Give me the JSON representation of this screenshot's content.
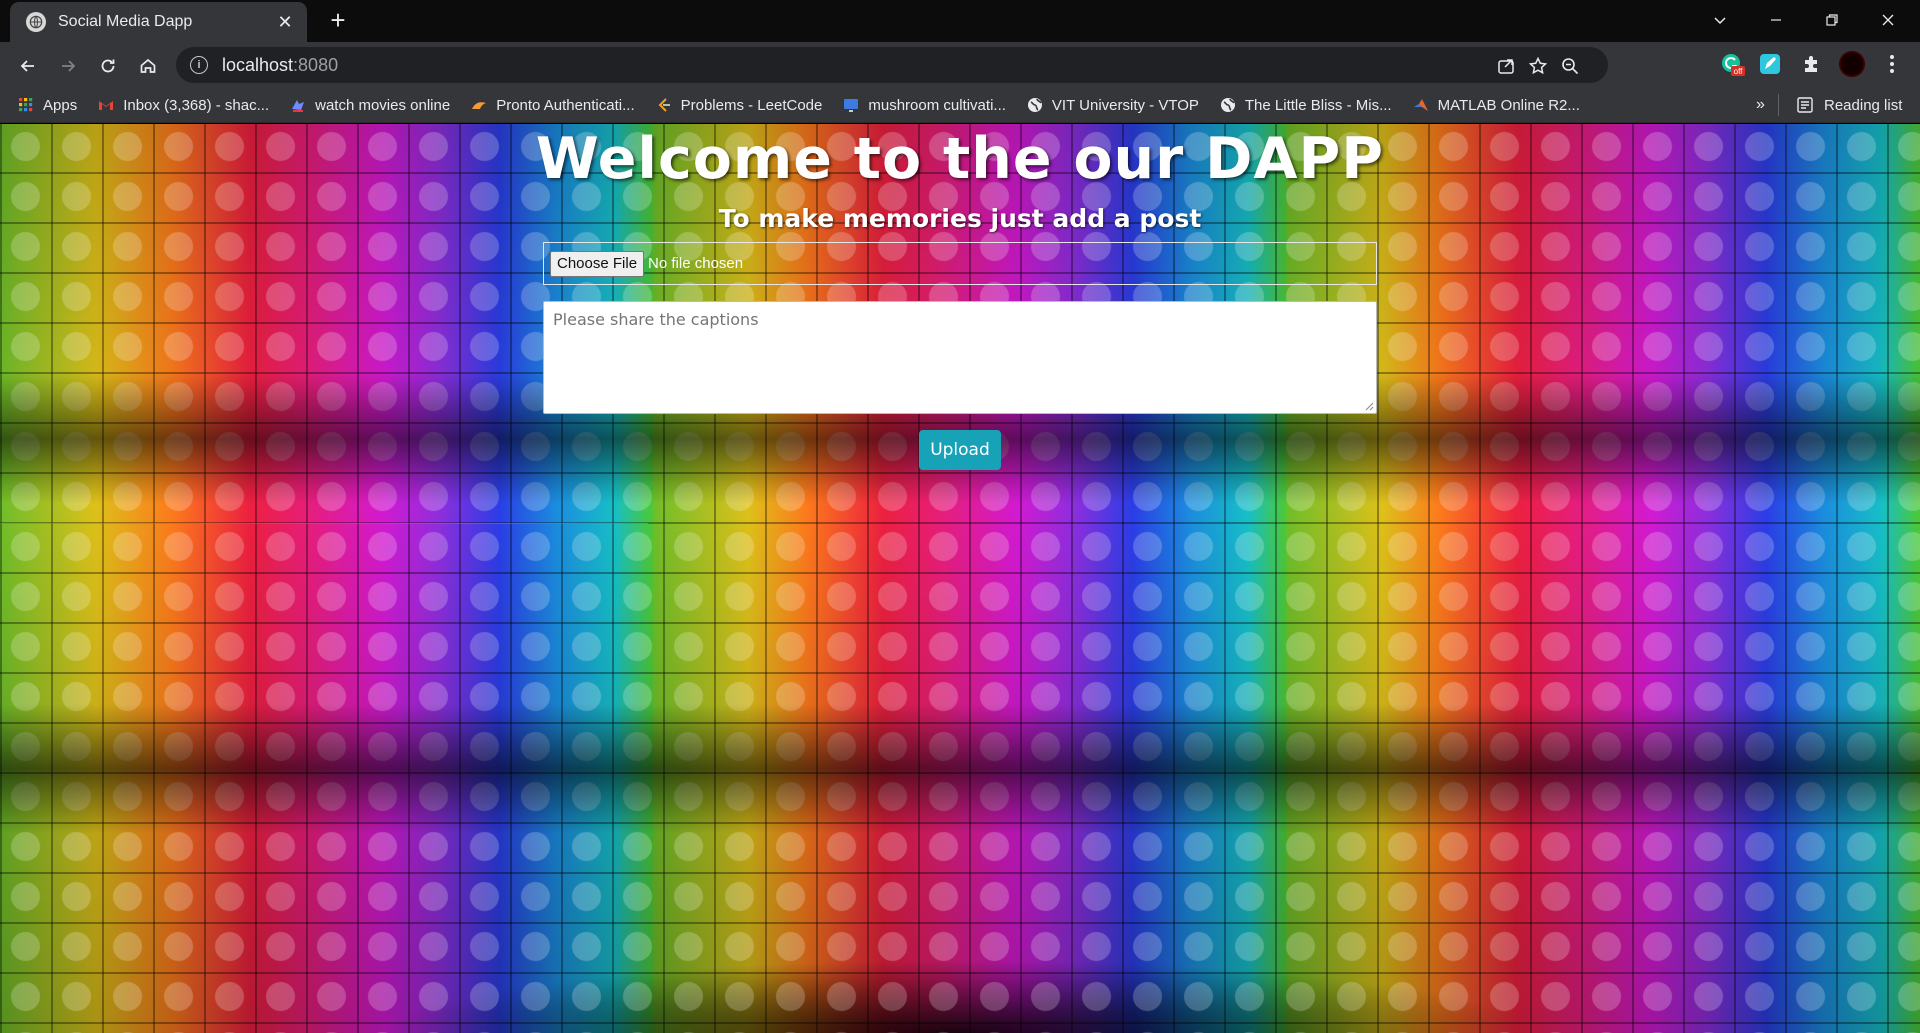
{
  "browser": {
    "tab": {
      "title": "Social Media Dapp",
      "close_glyph": "✕"
    },
    "new_tab_glyph": "+",
    "address": {
      "host": "localhost",
      "port": ":8080"
    },
    "bookmarks": [
      {
        "label": "Apps",
        "icon": "apps-grid-icon",
        "color": "#ea4335"
      },
      {
        "label": "Inbox (3,368) - shac...",
        "icon": "gmail-icon",
        "color": "#ea4335"
      },
      {
        "label": "watch movies online",
        "icon": "movie-site-icon",
        "color": "#6c8cff"
      },
      {
        "label": "Pronto Authenticati...",
        "icon": "pronto-icon",
        "color": "#f29b38"
      },
      {
        "label": "Problems - LeetCode",
        "icon": "leetcode-icon",
        "color": "#f89f1b"
      },
      {
        "label": "mushroom cultivati...",
        "icon": "video-icon",
        "color": "#3d7be0"
      },
      {
        "label": "VIT University - VTOP",
        "icon": "globe-icon",
        "color": "#e8eaed"
      },
      {
        "label": "The Little Bliss - Mis...",
        "icon": "globe-icon",
        "color": "#e8eaed"
      },
      {
        "label": "MATLAB Online R2...",
        "icon": "matlab-icon",
        "color": "#e16737"
      }
    ],
    "more_glyph": "»",
    "reading_list": "Reading list",
    "extension_badge": "off"
  },
  "page": {
    "heading": "Welcome to the our DAPP",
    "subheading": "To make memories just add a post",
    "file_input": {
      "button_label": "Choose File",
      "status": "No file chosen"
    },
    "caption": {
      "placeholder": "Please share the captions"
    },
    "upload_label": "Upload",
    "colors": {
      "upload_button": "#17a2b8",
      "text": "#ffffff"
    }
  }
}
